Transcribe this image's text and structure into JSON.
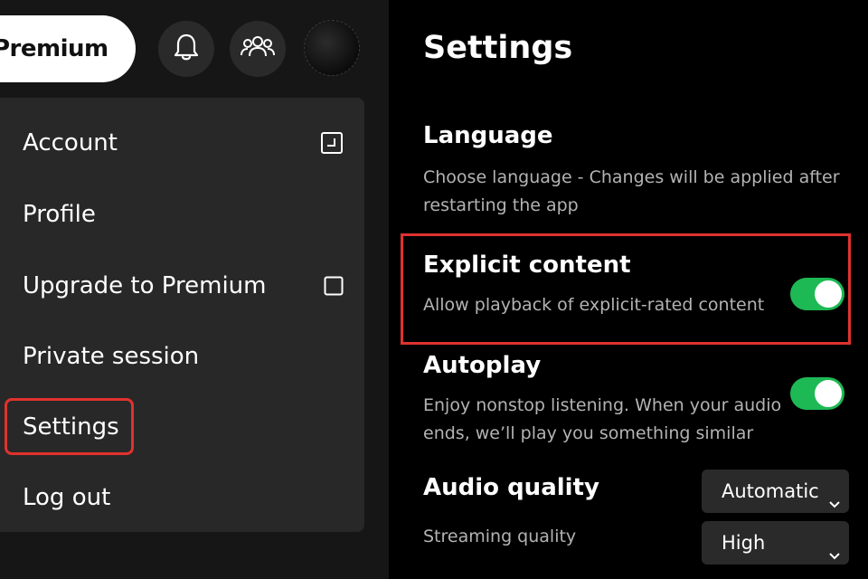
{
  "header": {
    "premium_label": "Premium",
    "icons": [
      "bell-icon",
      "friends-icon",
      "avatar"
    ]
  },
  "menu": {
    "items": [
      {
        "label": "Account",
        "icon": "external-link-icon"
      },
      {
        "label": "Profile"
      },
      {
        "label": "Upgrade to Premium",
        "icon": "external-link-icon"
      },
      {
        "label": "Private session"
      },
      {
        "label": "Settings",
        "highlighted": true
      },
      {
        "label": "Log out"
      }
    ]
  },
  "settings": {
    "title": "Settings",
    "language": {
      "title": "Language",
      "description": "Choose language - Changes will be applied after restarting the app"
    },
    "explicit": {
      "title": "Explicit content",
      "description": "Allow playback of explicit-rated content",
      "enabled": true,
      "highlighted": true
    },
    "autoplay": {
      "title": "Autoplay",
      "description": "Enjoy nonstop listening. When your audio ends, we’ll play you something similar",
      "enabled": true
    },
    "audio_quality": {
      "title": "Audio quality",
      "selected": "Automatic",
      "streaming_label": "Streaming quality",
      "streaming_selected": "High"
    }
  },
  "colors": {
    "accent_green": "#1db954",
    "highlight_red": "#e0322e",
    "background": "#121212"
  }
}
